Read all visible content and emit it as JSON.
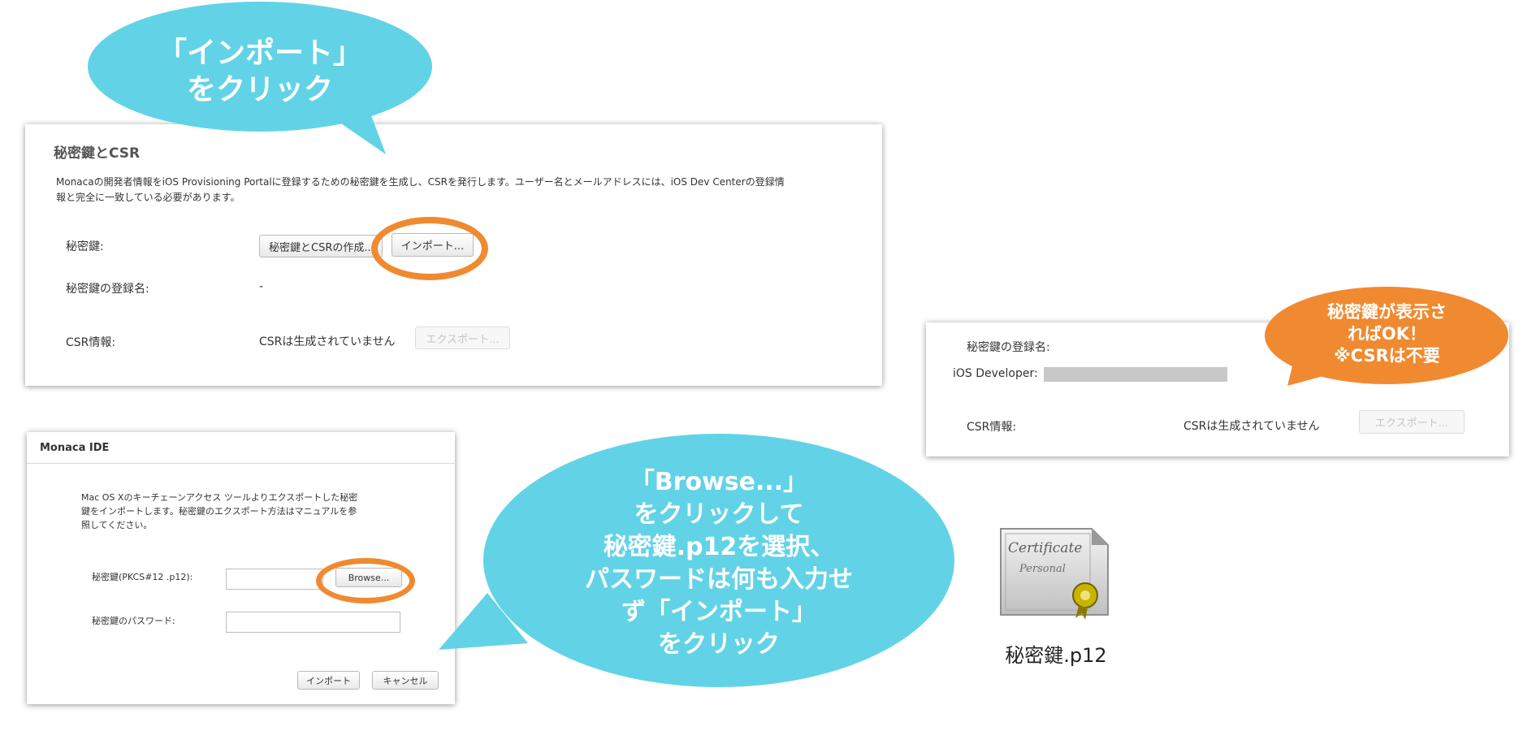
{
  "bubble_import": {
    "line1": "「インポート」",
    "line2": "をクリック"
  },
  "main_panel": {
    "title": "秘密鍵とCSR",
    "desc_line1": "Monacaの開発者情報をiOS Provisioning Portalに登録するための秘密鍵を生成し、CSRを発行します。ユーザー名とメールアドレスには、iOS Dev Centerの登録情",
    "desc_line2": "報と完全に一致している必要があります。",
    "private_key_label": "秘密鍵:",
    "create_button": "秘密鍵とCSRの作成...",
    "import_button": "インポート...",
    "registered_name_label": "秘密鍵の登録名:",
    "registered_name_value": "-",
    "csr_label": "CSR情報:",
    "csr_value": "CSRは生成されていません",
    "export_button": "エクスポート..."
  },
  "dialog": {
    "title": "Monaca IDE",
    "desc_line1": "Mac OS Xのキーチェーンアクセス ツールよりエクスポートした秘密",
    "desc_line2": "鍵をインポートします。秘密鍵のエクスポート方法はマニュアルを参",
    "desc_line3": "照してください。",
    "file_label": "秘密鍵(PKCS#12 .p12):",
    "browse_button": "Browse...",
    "password_label": "秘密鍵のパスワード:",
    "import_button": "インポート",
    "cancel_button": "キャンセル"
  },
  "bubble_browse": {
    "line1": "「Browse...」",
    "line2": "をクリックして",
    "line3": "秘密鍵.p12を選択、",
    "line4": "パスワードは何も入力せ",
    "line5": "ず「インポート」",
    "line6": "をクリック"
  },
  "result_panel": {
    "registered_name_label": "秘密鍵の登録名:",
    "developer_label": "iOS Developer:",
    "csr_label": "CSR情報:",
    "csr_value": "CSRは生成されていません",
    "export_button": "エクスポート..."
  },
  "bubble_ok": {
    "line1": "秘密鍵が表示さ",
    "line2": "ればOK！",
    "line3": "※CSRは不要"
  },
  "certificate": {
    "icon": "certificate-icon",
    "icon_text_top": "Certificate",
    "icon_text_bottom": "Personal",
    "filename": "秘密鍵.p12"
  },
  "colors": {
    "blue_bubble": "#62d3e6",
    "orange_accent": "#f08a30"
  }
}
